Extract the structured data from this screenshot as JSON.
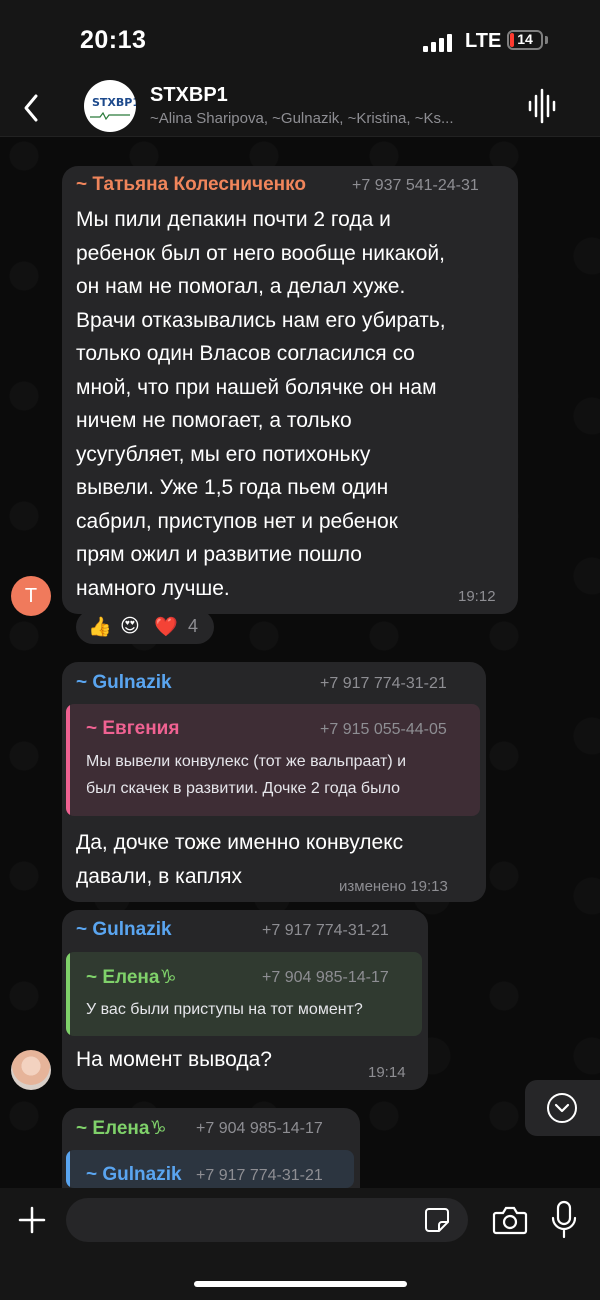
{
  "status_bar": {
    "time": "20:13",
    "network": "LTE",
    "battery": "14",
    "battery_level_percent": 14
  },
  "header": {
    "title": "STXBP1",
    "subtitle": "~Alina Sharipova, ~Gulnazik, ~Kristina, ~Ks...",
    "avatar_logo_text": "STXBP1"
  },
  "messages": [
    {
      "sender": "~ Татьяна Колесниченко",
      "phone": "+7 937 541-24-31",
      "lines": [
        "Мы пили депакин почти 2 года и",
        "ребенок был от него вообще никакой,",
        "он нам не помогал, а делал хуже.",
        "Врачи отказывались нам его убирать,",
        "только один Власов согласился со",
        "мной, что при нашей болячке он нам",
        "ничем не помогает, а только",
        "усугубляет, мы его потихоньку",
        "вывели. Уже 1,5 года пьем один",
        "сабрил, приступов нет и ребенок",
        "прям ожил и развитие пошло",
        "намного лучше."
      ],
      "time": "19:12",
      "avatar_initial": "Т",
      "reactions": [
        "👍",
        "😍",
        "❤️"
      ],
      "reaction_count": "4"
    },
    {
      "sender": "~ Gulnazik",
      "phone": "+7 917 774-31-21",
      "reply": {
        "sender": "~ Евгения",
        "phone": "+7 915 055-44-05",
        "lines": [
          "Мы вывели конвулекс (тот же вальпраат) и",
          "был скачек в развитии. Дочке 2 года было"
        ]
      },
      "lines": [
        "Да, дочке тоже именно конвулекс",
        "давали, в каплях"
      ],
      "time": "изменено 19:13"
    },
    {
      "sender": "~ Gulnazik",
      "phone": "+7 917 774-31-21",
      "reply": {
        "sender": "~ Елена♑",
        "phone": "+7 904 985-14-17",
        "lines": [
          "У вас были приступы на тот момент?"
        ]
      },
      "lines": [
        "На момент вывода?"
      ],
      "time": "19:14"
    },
    {
      "sender": "~ Елена♑",
      "phone": "+7 904 985-14-17",
      "reply": {
        "sender": "~ Gulnazik",
        "phone": "+7 917 774-31-21"
      }
    }
  ],
  "input": {
    "placeholder": ""
  },
  "colors": {
    "bubble": "#262628",
    "orange_name": "#f0855b",
    "blue_name": "#5aa5f0",
    "pink_name": "#f06292",
    "green_name": "#7fd16a"
  },
  "icons": [
    "back-icon",
    "waveform-icon",
    "chevron-down-icon",
    "plus-icon",
    "sticker-icon",
    "camera-icon",
    "microphone-icon"
  ]
}
